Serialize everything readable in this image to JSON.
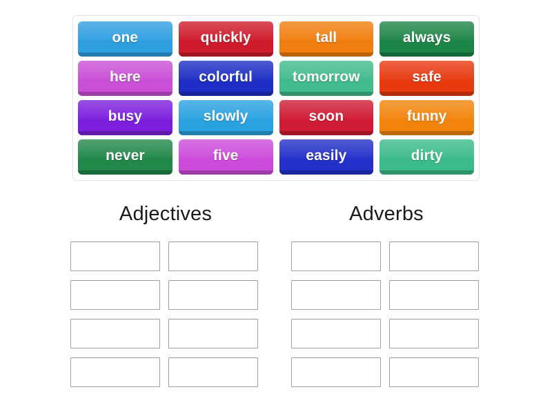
{
  "activity": {
    "type": "group-sort",
    "word_bank": {
      "tiles": [
        {
          "label": "one",
          "color": "#2f9ee0"
        },
        {
          "label": "quickly",
          "color": "#cf1b2b"
        },
        {
          "label": "tall",
          "color": "#f07e0e"
        },
        {
          "label": "always",
          "color": "#1d8547"
        },
        {
          "label": "here",
          "color": "#c94fd6"
        },
        {
          "label": "colorful",
          "color": "#1e2ec4"
        },
        {
          "label": "tomorrow",
          "color": "#40bb8b"
        },
        {
          "label": "safe",
          "color": "#e8390f"
        },
        {
          "label": "busy",
          "color": "#7d20dd"
        },
        {
          "label": "slowly",
          "color": "#2aa2e0"
        },
        {
          "label": "soon",
          "color": "#cf1b33"
        },
        {
          "label": "funny",
          "color": "#f2840c"
        },
        {
          "label": "never",
          "color": "#21884a"
        },
        {
          "label": "five",
          "color": "#cd4bdb"
        },
        {
          "label": "easily",
          "color": "#2330c9"
        },
        {
          "label": "dirty",
          "color": "#3cbb8a"
        }
      ]
    },
    "groups": [
      {
        "title": "Adjectives",
        "slots": [
          "",
          "",
          "",
          "",
          "",
          "",
          "",
          ""
        ]
      },
      {
        "title": "Adverbs",
        "slots": [
          "",
          "",
          "",
          "",
          "",
          "",
          "",
          ""
        ]
      }
    ]
  }
}
